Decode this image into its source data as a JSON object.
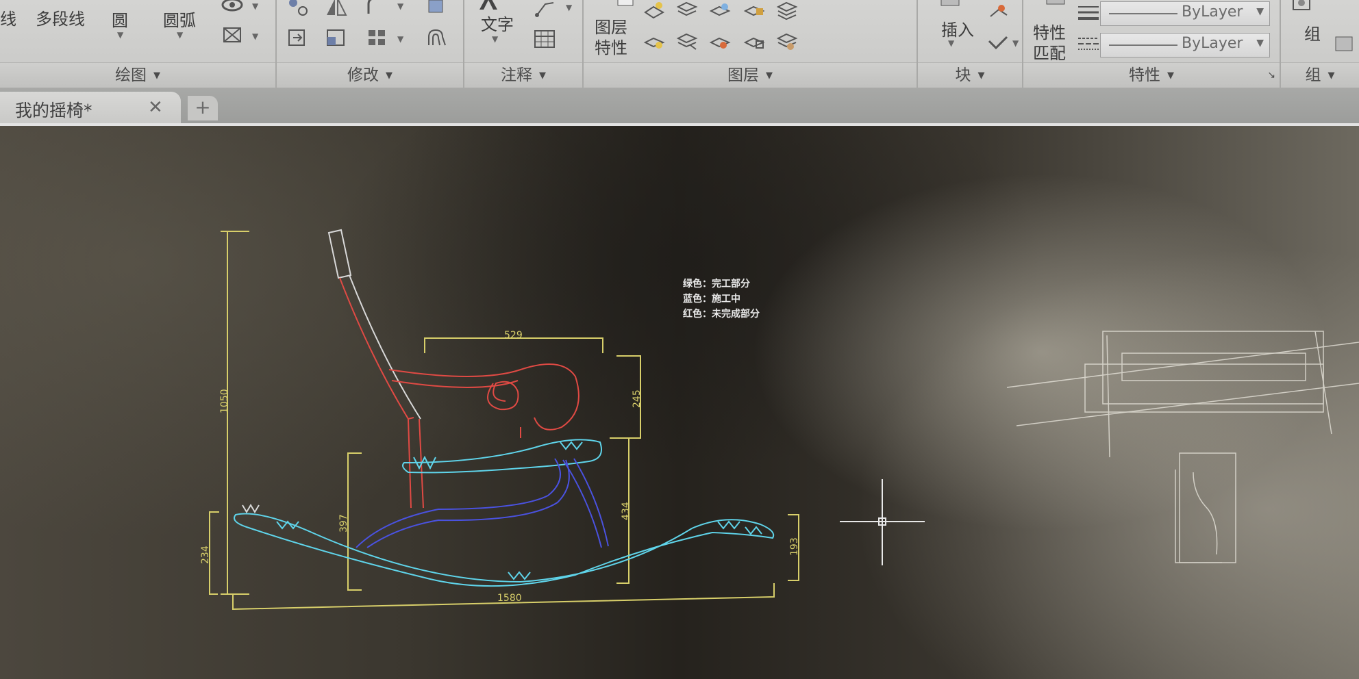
{
  "ribbon": {
    "draw_panel": {
      "line_label": "线",
      "polyline_label": "多段线",
      "circle_label": "圆",
      "arc_label": "圆弧",
      "title": "绘图"
    },
    "modify_panel": {
      "title": "修改"
    },
    "annotate_panel": {
      "text_label": "文字",
      "title": "注释"
    },
    "layers_panel": {
      "layer_props_label_1": "图层",
      "layer_props_label_2": "特性",
      "title": "图层"
    },
    "block_panel": {
      "insert_label": "插入",
      "title": "块"
    },
    "properties_panel": {
      "match_label_1": "特性",
      "match_label_2": "匹配",
      "color_value": "ByLayer",
      "linetype_value": "ByLayer",
      "title": "特性"
    },
    "group_panel": {
      "group_label": "组",
      "title": "组"
    }
  },
  "tabs": {
    "active_document": "我的摇椅*"
  },
  "drawing": {
    "legend": [
      "绿色：完工部分",
      "蓝色：施工中",
      "红色：未完成部分"
    ],
    "dimensions": {
      "total_height": "1050",
      "seat_width": "529",
      "arm_height": "245",
      "seat_height": "397",
      "arm_to_base": "434",
      "rocker_left": "234",
      "rocker_right": "193",
      "total_length": "1580"
    }
  },
  "colors": {
    "canvas": "#2a2621",
    "completed": "#5fd4ea",
    "in_progress": "#4a52e0",
    "unfinished": "#e04a44",
    "dimension": "#d8cf6a"
  }
}
